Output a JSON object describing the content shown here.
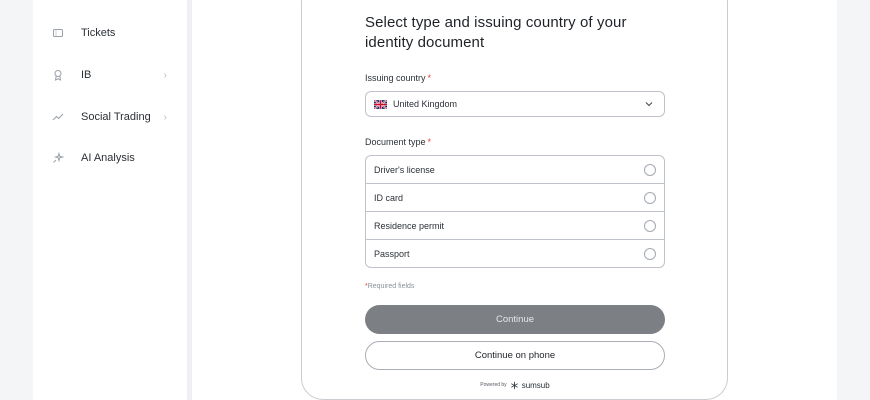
{
  "sidebar": {
    "items": [
      {
        "label": "Tickets",
        "icon": "ticket-icon",
        "chevron": ""
      },
      {
        "label": "IB",
        "icon": "award-icon",
        "chevron": "›"
      },
      {
        "label": "Social Trading",
        "icon": "trend-icon",
        "chevron": "›"
      },
      {
        "label": "AI Analysis",
        "icon": "sparkle-icon",
        "chevron": ""
      }
    ]
  },
  "form": {
    "title": "Select type and issuing country of your identity document",
    "country_label": "Issuing country",
    "required_mark": "*",
    "country_value": "United Kingdom",
    "doc_type_label": "Document type",
    "doc_types": [
      "Driver's license",
      "ID card",
      "Residence permit",
      "Passport"
    ],
    "required_note_mark": "*",
    "required_note": "Required fields",
    "continue_label": "Continue",
    "continue_phone_label": "Continue on phone",
    "powered_by": "Powered by",
    "brand": "sumsub"
  },
  "colors": {
    "continue_bg": "#7c7f83",
    "required_red": "#e23c3c",
    "card_border": "#c9ccd1"
  }
}
